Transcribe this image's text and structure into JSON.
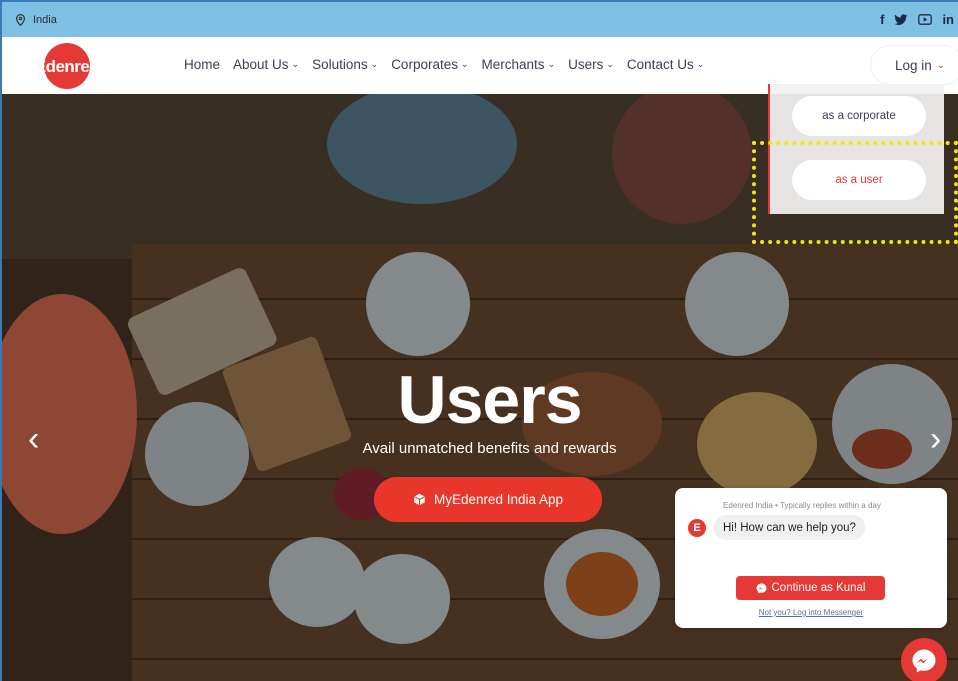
{
  "topbar": {
    "location": "India",
    "social": [
      "f",
      "t",
      "yt",
      "in"
    ]
  },
  "brand": {
    "logo_text": "Edenred",
    "color": "#e53935"
  },
  "nav": {
    "items": [
      {
        "label": "Home",
        "has_dropdown": false
      },
      {
        "label": "About Us",
        "has_dropdown": true
      },
      {
        "label": "Solutions",
        "has_dropdown": true
      },
      {
        "label": "Corporates",
        "has_dropdown": true
      },
      {
        "label": "Merchants",
        "has_dropdown": true
      },
      {
        "label": "Users",
        "has_dropdown": true
      },
      {
        "label": "Contact Us",
        "has_dropdown": true
      }
    ],
    "login_label": "Log in"
  },
  "login_menu": {
    "corporate": "as a corporate",
    "user": "as a user"
  },
  "hero": {
    "title": "Users",
    "subtitle": "Avail unmatched benefits and rewards",
    "button_label": "MyEdenred India App"
  },
  "chat": {
    "meta": "Edenred India • Typically replies within a day",
    "message": "Hi! How can we help you?",
    "continue_label": "Continue as Kunal",
    "alt_link": "Not you? Log into Messenger"
  },
  "colors": {
    "accent": "#e53935",
    "topbar": "#7fbfe3",
    "highlight": "#f5e800"
  }
}
